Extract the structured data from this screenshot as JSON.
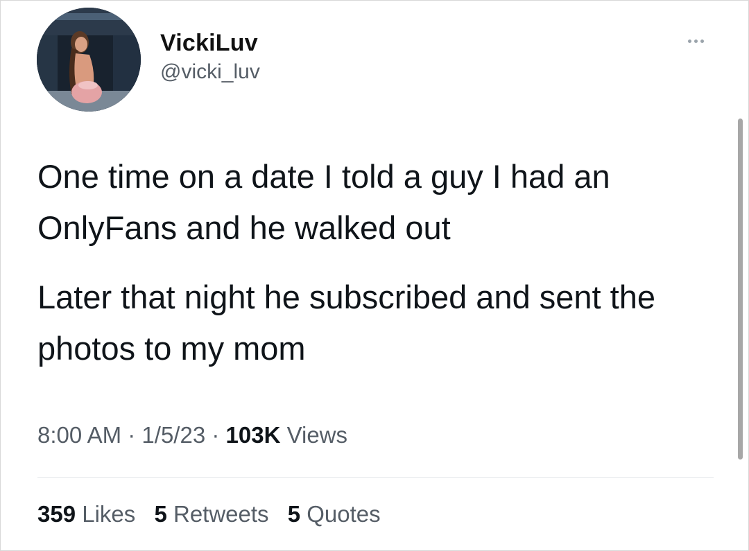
{
  "user": {
    "display_name": "VickiLuv",
    "handle": "@vicki_luv"
  },
  "more_menu_icon": "ellipsis-icon",
  "tweet": {
    "paragraphs": [
      "One time on a date I told a guy I had an OnlyFans and he walked out",
      "Later that night he subscribed and sent the photos to my mom"
    ],
    "time": "8:00 AM",
    "date": "1/5/23",
    "separator": "·",
    "views_count": "103K",
    "views_label": "Views"
  },
  "stats": {
    "likes_count": "359",
    "likes_label": "Likes",
    "retweets_count": "5",
    "retweets_label": "Retweets",
    "quotes_count": "5",
    "quotes_label": "Quotes"
  }
}
